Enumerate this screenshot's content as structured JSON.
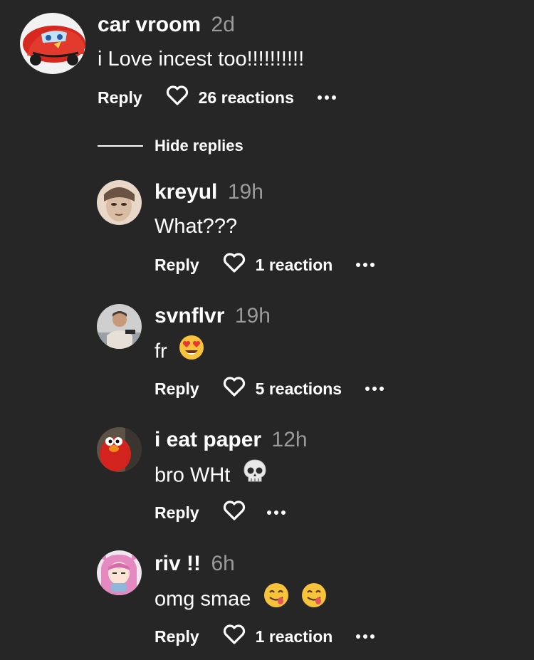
{
  "comment": {
    "username": "car vroom",
    "time": "2d",
    "text": "i Love incest too!!!!!!!!!!",
    "reply_label": "Reply",
    "reactions": "26 reactions"
  },
  "hide_replies_label": "Hide replies",
  "replies": [
    {
      "username": "kreyul",
      "time": "19h",
      "text": "What???",
      "emojis": [],
      "reply_label": "Reply",
      "reactions": "1 reaction"
    },
    {
      "username": "svnflvr",
      "time": "19h",
      "text": "fr",
      "emojis": [
        "heart-eyes"
      ],
      "reply_label": "Reply",
      "reactions": "5 reactions"
    },
    {
      "username": "i eat paper",
      "time": "12h",
      "text": "bro WHt",
      "emojis": [
        "skull"
      ],
      "reply_label": "Reply",
      "reactions": ""
    },
    {
      "username": "riv !!",
      "time": "6h",
      "text": "omg smae",
      "emojis": [
        "yum",
        "yum"
      ],
      "reply_label": "Reply",
      "reactions": "1 reaction"
    }
  ],
  "colors": {
    "background": "#262626",
    "text": "#ffffff",
    "muted": "#9a9a9a",
    "emoji_yellow": "#f7c33b"
  }
}
